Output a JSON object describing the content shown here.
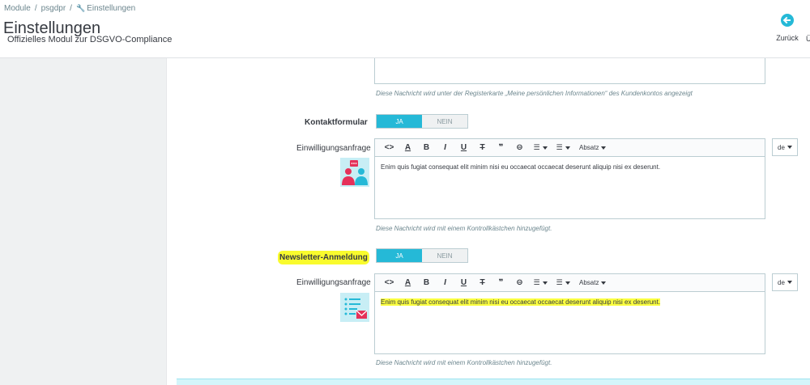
{
  "breadcrumb": {
    "items": [
      "Module",
      "psgdpr",
      "Einstellungen"
    ]
  },
  "header": {
    "title": "Einstellungen",
    "subtitle": "Offizielles Modul zur DSGVO-Compliance",
    "back_label": "Zurück",
    "cut_label": "Ü"
  },
  "previous": {
    "help": "Diese Nachricht wird unter der Registerkarte „Meine persönlichen Informationen“ des Kundenkontos angezeigt"
  },
  "toolbar": {
    "code": "<>",
    "color": "A",
    "bold": "B",
    "italic": "I",
    "underline": "U",
    "strike": "T",
    "quote": "❞",
    "link": "⊖",
    "ul": "☰",
    "ol": "☰",
    "paragraph": "Absatz"
  },
  "contact": {
    "label": "Kontaktformular",
    "toggle_on": "JA",
    "toggle_off": "NEIN",
    "consent_label": "Einwilligungsanfrage",
    "text": "Enim quis fugiat consequat elit minim nisi eu occaecat occaecat deserunt aliquip nisi ex deserunt.",
    "help": "Diese Nachricht wird mit einem Kontrollkästchen hinzugefügt.",
    "lang": "de"
  },
  "newsletter": {
    "label": "Newsletter-Anmeldung",
    "toggle_on": "JA",
    "toggle_off": "NEIN",
    "consent_label": "Einwilligungsanfrage",
    "text": "Enim quis fugiat consequat elit minim nisi eu occaecat occaecat deserunt aliquip nisi ex deserunt.",
    "help": "Diese Nachricht wird mit einem Kontrollkästchen hinzugefügt.",
    "lang": "de"
  },
  "colors": {
    "accent": "#25b9d7",
    "highlight": "#fbff40",
    "icon_pink": "#e5315a"
  }
}
